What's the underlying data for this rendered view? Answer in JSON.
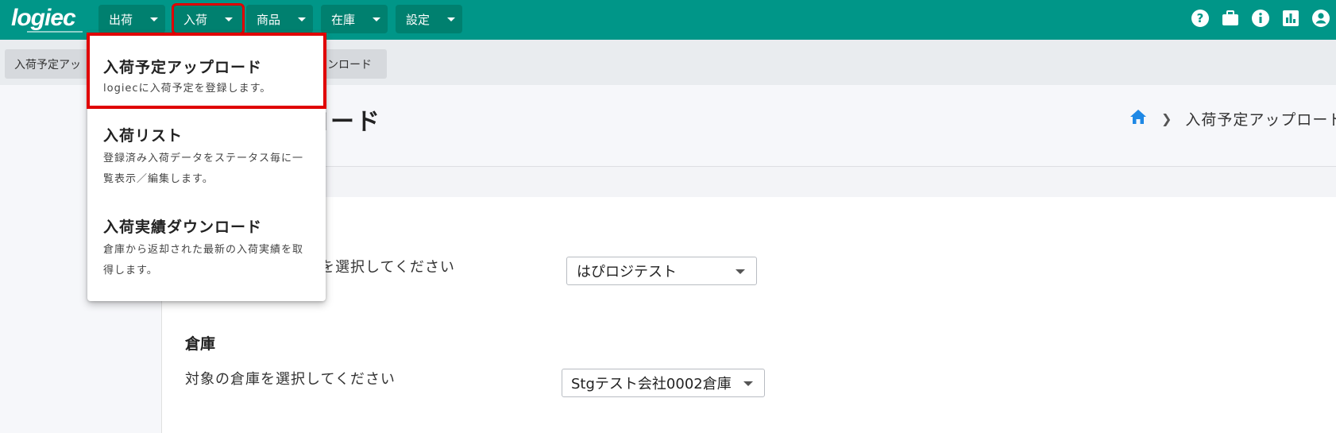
{
  "header": {
    "logo": "logiec",
    "nav": [
      {
        "label": "出荷"
      },
      {
        "label": "入荷"
      },
      {
        "label": "商品"
      },
      {
        "label": "在庫"
      },
      {
        "label": "設定"
      }
    ],
    "icons": [
      "help-icon",
      "briefcase-icon",
      "info-icon",
      "chart-icon",
      "account-icon"
    ]
  },
  "subbar": {
    "tab_left": "入荷予定アッ",
    "tab_right": "ンロード"
  },
  "page": {
    "title": "ロード",
    "breadcrumb_current": "入荷予定アップロード"
  },
  "form": {
    "company_prompt": "を選択してください",
    "company_value": "はぴロジテスト",
    "warehouse_section": "倉庫",
    "warehouse_prompt": "対象の倉庫を選択してください",
    "warehouse_value": "Stgテスト会社0002倉庫"
  },
  "dropdown": {
    "items": [
      {
        "title": "入荷予定アップロード",
        "desc": "logiecに入荷予定を登録します。"
      },
      {
        "title": "入荷リスト",
        "desc": "登録済み入荷データをステータス毎に一覧表示／編集します。"
      },
      {
        "title": "入荷実績ダウンロード",
        "desc": "倉庫から返却された最新の入荷実績を取得します。"
      }
    ]
  },
  "colors": {
    "header_bg": "#009688",
    "highlight": "#e00000",
    "home_icon": "#1e88e5"
  }
}
